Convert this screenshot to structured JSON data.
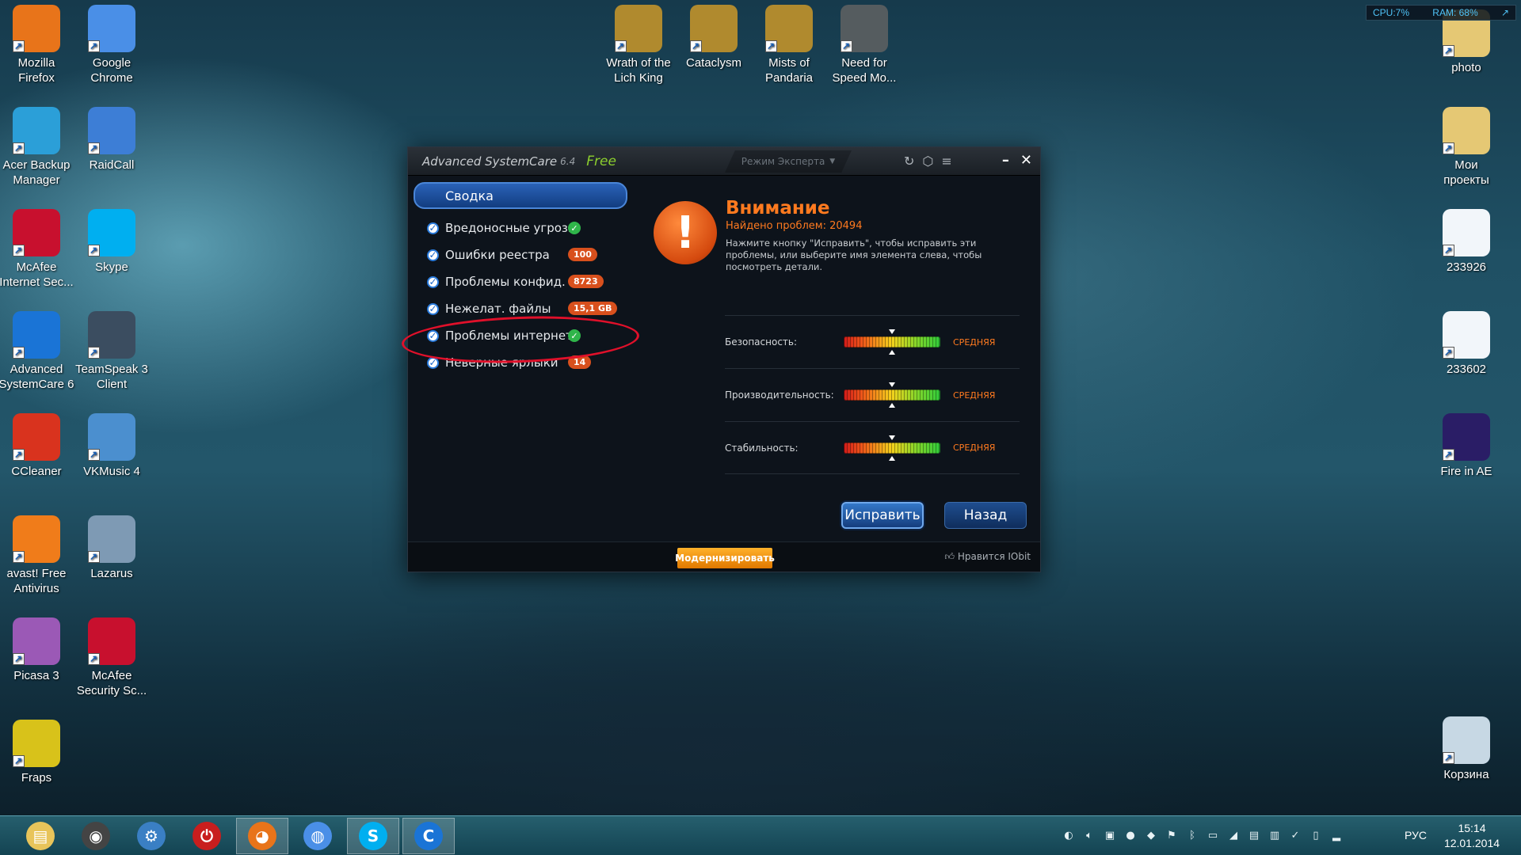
{
  "desktop": {
    "left_icons": [
      {
        "label": "Mozilla\nFirefox",
        "icon": "firefox-icon",
        "color": "#e8741a"
      },
      {
        "label": "Google\nChrome",
        "icon": "chrome-icon",
        "color": "#4a8fe7"
      },
      {
        "label": "Acer Backup\nManager",
        "icon": "backup-icon",
        "color": "#2b9fd8"
      },
      {
        "label": "RaidCall",
        "icon": "raidcall-icon",
        "color": "#3d7ed6"
      },
      {
        "label": "McAfee\nInternet Sec...",
        "icon": "mcafee-icon",
        "color": "#c8102e"
      },
      {
        "label": "Skype",
        "icon": "skype-icon",
        "color": "#00aff0"
      },
      {
        "label": "Advanced\nSystemCare 6",
        "icon": "advanced-systemcare-icon",
        "color": "#1a74d6"
      },
      {
        "label": "TeamSpeak 3\nClient",
        "icon": "teamspeak-icon",
        "color": "#3b4d60"
      },
      {
        "label": "CCleaner",
        "icon": "ccleaner-icon",
        "color": "#d9331e"
      },
      {
        "label": "VKMusic 4",
        "icon": "vkmusic-icon",
        "color": "#4b8fcf"
      },
      {
        "label": "avast! Free\nAntivirus",
        "icon": "avast-icon",
        "color": "#f07c1a"
      },
      {
        "label": "Lazarus",
        "icon": "lazarus-icon",
        "color": "#7e9ab4"
      },
      {
        "label": "Picasa 3",
        "icon": "picasa-icon",
        "color": "#9b59b6"
      },
      {
        "label": "McAfee\nSecurity Sc...",
        "icon": "mcafee-security-icon",
        "color": "#c8102e"
      },
      {
        "label": "Fraps",
        "icon": "fraps-icon",
        "color": "#d8c21a"
      }
    ],
    "top_icons": [
      {
        "label": "Wrath of the\nLich King",
        "icon": "wow-icon",
        "color": "#b08a2e"
      },
      {
        "label": "Cataclysm",
        "icon": "wow-cataclysm-icon",
        "color": "#b08a2e"
      },
      {
        "label": "Mists of\nPandaria",
        "icon": "wow-pandaria-icon",
        "color": "#b08a2e"
      },
      {
        "label": "Need for\nSpeed Mo...",
        "icon": "nfs-icon",
        "color": "#555c5f"
      }
    ],
    "right_icons": [
      {
        "label": "photo",
        "icon": "photo-folder-icon",
        "color": "#e5c874"
      },
      {
        "label": "Мои\nпроекты",
        "icon": "projects-folder-icon",
        "color": "#e5c874"
      },
      {
        "label": "233926",
        "icon": "mp3-file-icon",
        "color": "#f2f6fa"
      },
      {
        "label": "233602",
        "icon": "mp3-file-icon",
        "color": "#f2f6fa"
      },
      {
        "label": "Fire in AE",
        "icon": "after-effects-icon",
        "color": "#2a1d66"
      },
      {
        "label": "Корзина",
        "icon": "recycle-bin-icon",
        "color": "#c7d8e4"
      }
    ]
  },
  "sysmon": {
    "cpu": "CPU:7%",
    "ram": "RAM: 68%"
  },
  "app": {
    "title": "Advanced SystemCare",
    "version": "6.4",
    "edition": "Free",
    "mode_label": "Режим Эксперта",
    "nav_selected": "Сводка",
    "items": [
      {
        "label": "Вредоносные угрозы",
        "badge": "",
        "ok": true
      },
      {
        "label": "Ошибки реестра",
        "badge": "100",
        "ok": false
      },
      {
        "label": "Проблемы конфид.",
        "badge": "8723",
        "ok": false
      },
      {
        "label": "Нежелат. файлы",
        "badge": "15,1 GB",
        "ok": false
      },
      {
        "label": "Проблемы интернета",
        "badge": "",
        "ok": true
      },
      {
        "label": "Неверные ярлыки",
        "badge": "14",
        "ok": false
      }
    ],
    "warning": {
      "title": "Внимание",
      "found": "Найдено проблем: 20494",
      "description": "Нажмите кнопку \"Исправить\", чтобы исправить эти проблемы, или выберите имя элемента слева, чтобы посмотреть детали."
    },
    "meters": [
      {
        "label": "Безопасность:",
        "level": "СРЕДНЯЯ",
        "value": 0.5
      },
      {
        "label": "Производительность:",
        "level": "СРЕДНЯЯ",
        "value": 0.5
      },
      {
        "label": "Стабильность:",
        "level": "СРЕДНЯЯ",
        "value": 0.5
      }
    ],
    "fix_label": "Исправить",
    "back_label": "Назад",
    "upgrade_label": "Модернизировать",
    "like_label": "Нравится IObit"
  },
  "taskbar": {
    "apps": [
      {
        "icon": "file-explorer-icon",
        "color": "#e8c45a"
      },
      {
        "icon": "media-player-icon",
        "color": "#444"
      },
      {
        "icon": "control-panel-icon",
        "color": "#3a7fc4"
      },
      {
        "icon": "power-icon",
        "color": "#c81e1e"
      },
      {
        "icon": "firefox-icon",
        "color": "#e8741a",
        "active": true
      },
      {
        "icon": "chrome-icon",
        "color": "#4a8fe7"
      },
      {
        "icon": "skype-icon",
        "color": "#00aff0",
        "active": true
      },
      {
        "icon": "advanced-systemcare-icon",
        "color": "#1a74d6",
        "active": true
      }
    ],
    "language": "РУС",
    "time": "15:14",
    "date": "12.01.2014"
  }
}
